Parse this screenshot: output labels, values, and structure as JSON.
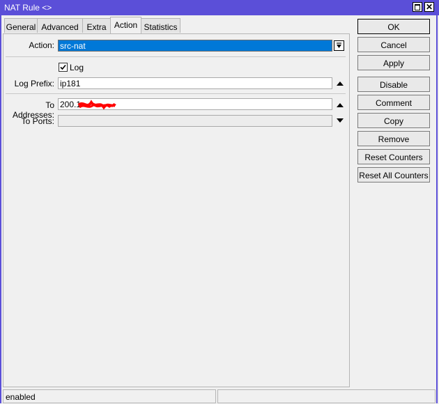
{
  "window": {
    "title": "NAT Rule <>"
  },
  "tabs": [
    {
      "label": "General"
    },
    {
      "label": "Advanced"
    },
    {
      "label": "Extra"
    },
    {
      "label": "Action"
    },
    {
      "label": "Statistics"
    }
  ],
  "form": {
    "action": {
      "label": "Action:",
      "value": "src-nat"
    },
    "log": {
      "label": "Log",
      "checked": true
    },
    "log_prefix": {
      "label": "Log Prefix:",
      "value": "ip181"
    },
    "to_addresses": {
      "label": "To Addresses:",
      "value": "200.1"
    },
    "to_ports": {
      "label": "To Ports:",
      "value": ""
    }
  },
  "buttons": {
    "ok": "OK",
    "cancel": "Cancel",
    "apply": "Apply",
    "disable": "Disable",
    "comment": "Comment",
    "copy": "Copy",
    "remove": "Remove",
    "reset_counters": "Reset Counters",
    "reset_all_counters": "Reset All Counters"
  },
  "status": {
    "text": "enabled"
  },
  "colors": {
    "titlebar": "#5b4fd8",
    "selection": "#0078d7",
    "redaction": "#ff0000"
  },
  "icons": [
    "maximize-icon",
    "close-icon",
    "dropdown-icon",
    "arrow-up-icon",
    "arrow-down-icon",
    "check-icon"
  ]
}
